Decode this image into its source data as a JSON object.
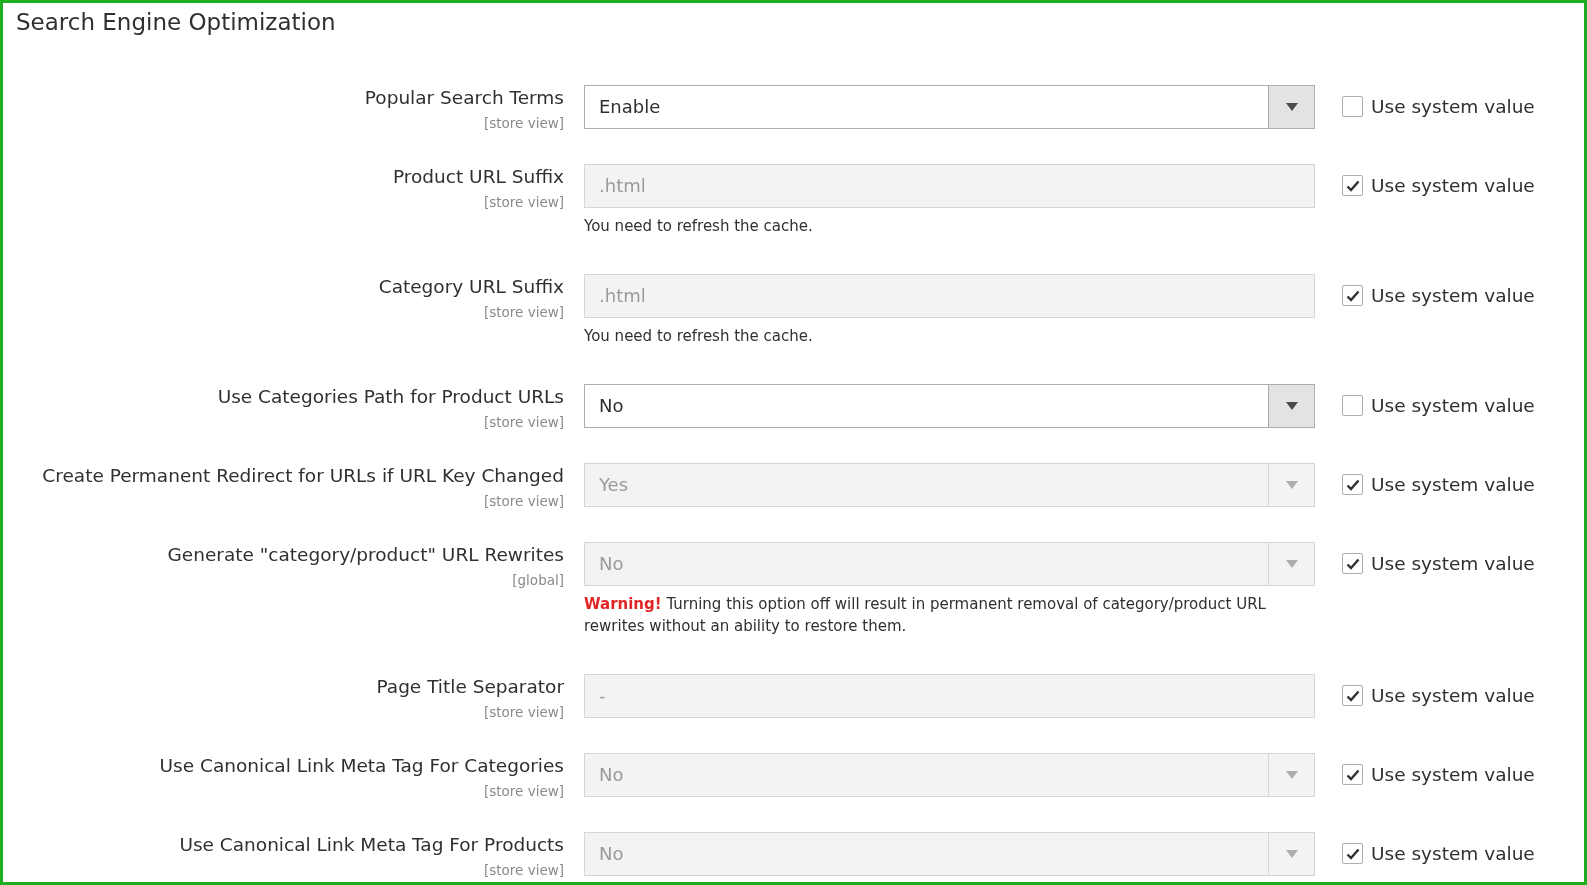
{
  "title": "Search Engine Optimization",
  "fields": [
    {
      "label": "Popular Search Terms",
      "scope": "[store view]",
      "kind": "select",
      "value": "Enable",
      "disabled": false,
      "use_system_value": {
        "label": "Use system value",
        "checked": false
      }
    },
    {
      "label": "Product URL Suffix",
      "scope": "[store view]",
      "kind": "text",
      "value": ".html",
      "disabled": true,
      "use_system_value": {
        "label": "Use system value",
        "checked": true
      },
      "note": "You need to refresh the cache."
    },
    {
      "label": "Category URL Suffix",
      "scope": "[store view]",
      "kind": "text",
      "value": ".html",
      "disabled": true,
      "use_system_value": {
        "label": "Use system value",
        "checked": true
      },
      "note": "You need to refresh the cache."
    },
    {
      "label": "Use Categories Path for Product URLs",
      "scope": "[store view]",
      "kind": "select",
      "value": "No",
      "disabled": false,
      "use_system_value": {
        "label": "Use system value",
        "checked": false
      }
    },
    {
      "label": "Create Permanent Redirect for URLs if URL Key Changed",
      "scope": "[store view]",
      "kind": "select",
      "value": "Yes",
      "disabled": true,
      "use_system_value": {
        "label": "Use system value",
        "checked": true
      }
    },
    {
      "label": "Generate \"category/product\" URL Rewrites",
      "scope": "[global]",
      "kind": "select",
      "value": "No",
      "disabled": true,
      "use_system_value": {
        "label": "Use system value",
        "checked": true
      },
      "warning_label": "Warning!",
      "note": "Turning this option off will result in permanent removal of category/product URL rewrites without an ability to restore them."
    },
    {
      "label": "Page Title Separator",
      "scope": "[store view]",
      "kind": "text",
      "value": "-",
      "disabled": true,
      "use_system_value": {
        "label": "Use system value",
        "checked": true
      }
    },
    {
      "label": "Use Canonical Link Meta Tag For Categories",
      "scope": "[store view]",
      "kind": "select",
      "value": "No",
      "disabled": true,
      "use_system_value": {
        "label": "Use system value",
        "checked": true
      }
    },
    {
      "label": "Use Canonical Link Meta Tag For Products",
      "scope": "[store view]",
      "kind": "select",
      "value": "No",
      "disabled": true,
      "use_system_value": {
        "label": "Use system value",
        "checked": true
      }
    }
  ]
}
